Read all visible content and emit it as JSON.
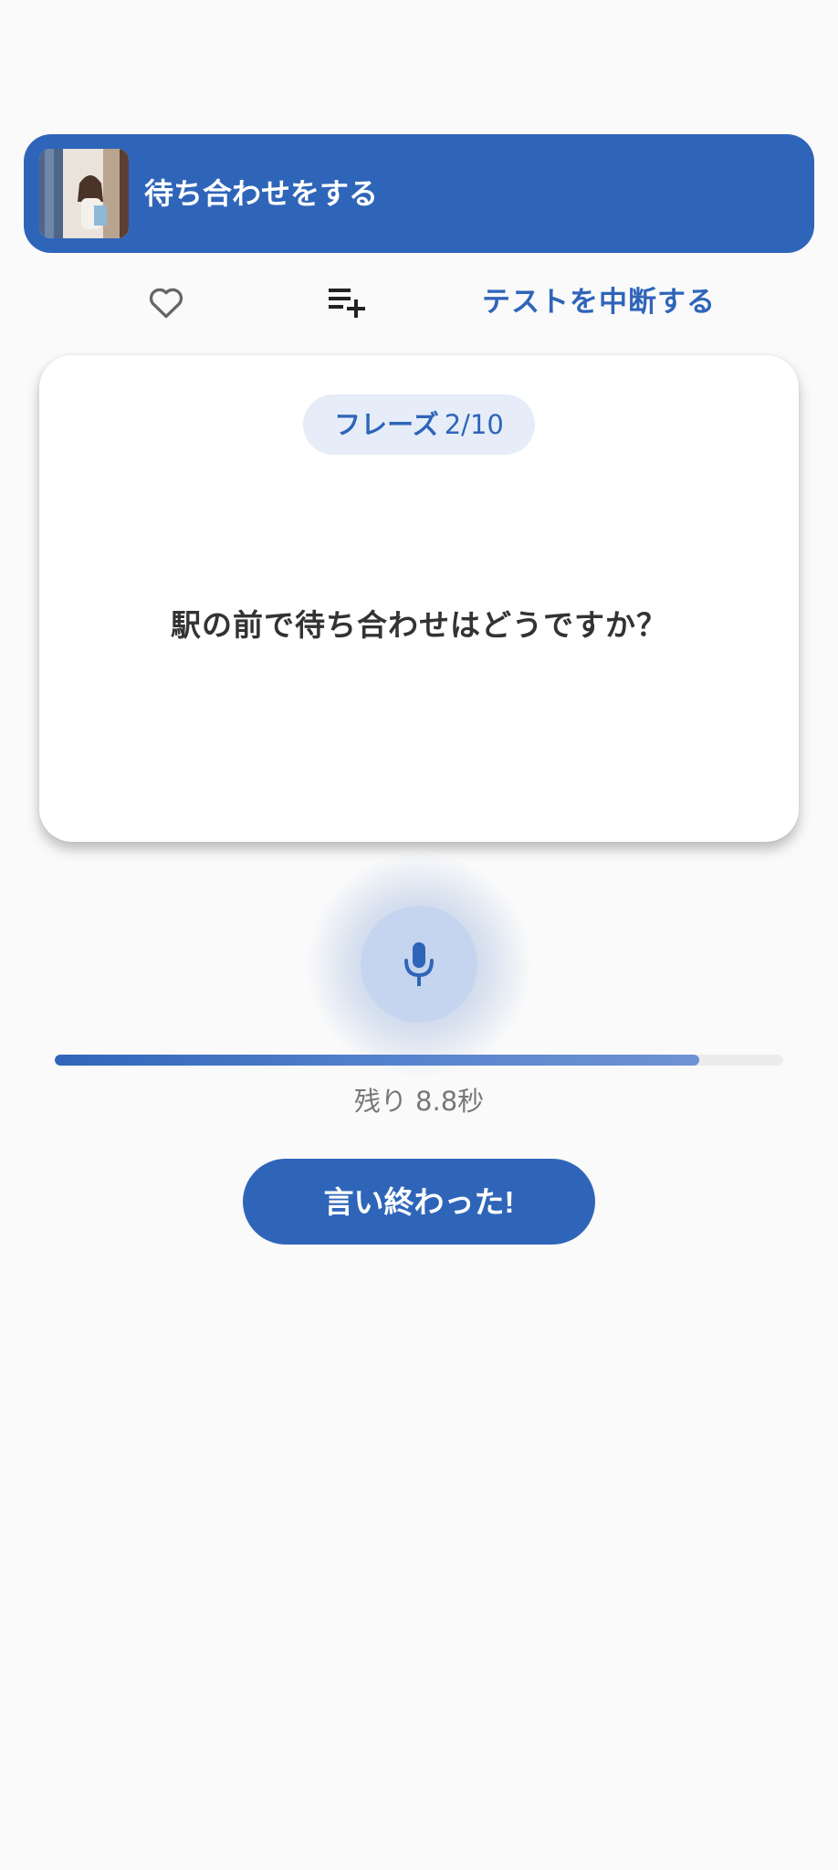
{
  "header": {
    "title": "待ち合わせをする",
    "thumbnail_icon": "lesson-thumbnail-photo"
  },
  "actions": {
    "favorite_icon": "heart-outline-icon",
    "add_to_list_icon": "playlist-add-icon",
    "stop_test_label": "テストを中断する"
  },
  "card": {
    "phrase_label": "フレーズ",
    "phrase_count": "2/10",
    "question": "駅の前で待ち合わせはどうですか？"
  },
  "recorder": {
    "mic_icon": "microphone-icon",
    "progress": 0.885,
    "remaining_text": "残り 8.8秒"
  },
  "done_button_label": "言い終わった!",
  "colors": {
    "accent": "#2f65b9",
    "background": "#fafafa",
    "pill_bg": "#e6edf8",
    "mic_bg": "#c5d5ef"
  }
}
